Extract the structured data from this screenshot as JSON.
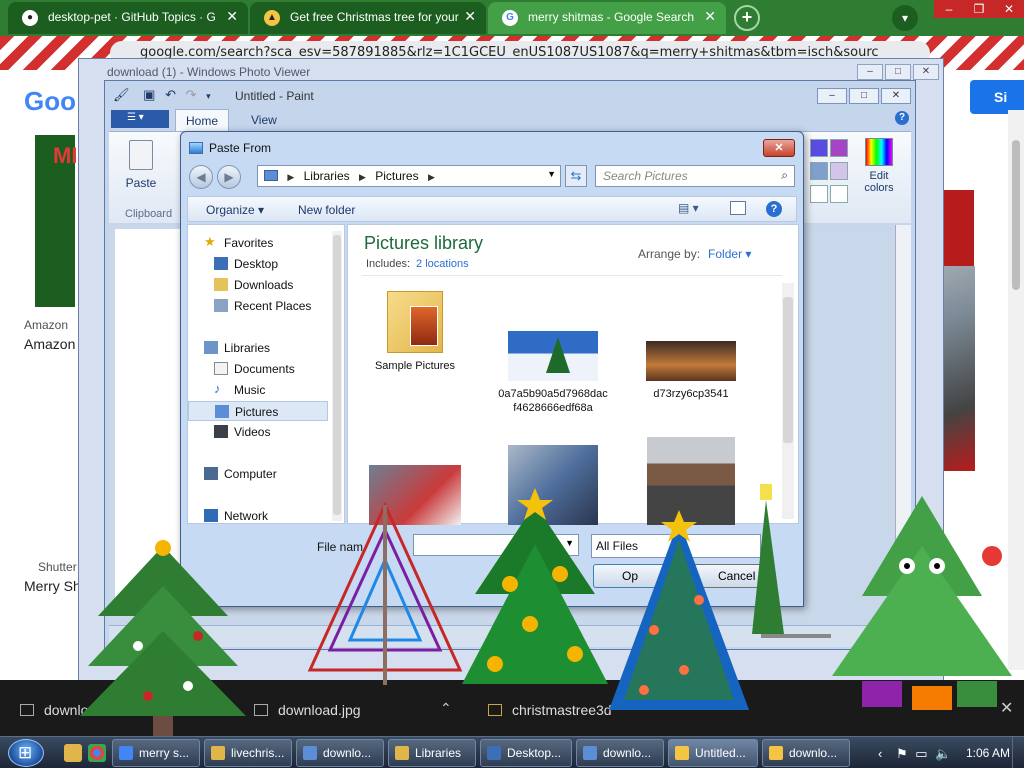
{
  "chrome": {
    "tabs": [
      {
        "title": "desktop-pet · GitHub Topics · G",
        "close": "✕"
      },
      {
        "title": "Get free Christmas tree for your",
        "close": "✕"
      },
      {
        "title": "merry shitmas - Google Search",
        "close": "✕"
      }
    ],
    "new_tab": "+",
    "address": "google.com/search?sca_esv=587891885&rlz=1C1GCEU_enUS1087US1087&q=merry+shitmas&tbm=isch&sourc",
    "signin_label": "Si",
    "left_results": [
      "Amazon",
      "Amazon",
      "Shutter",
      "Merry Sh"
    ],
    "left_logo": "Goo",
    "thumb_text": "MI"
  },
  "photo_viewer": {
    "title": "download (1) - Windows Photo Viewer"
  },
  "paint": {
    "title": "Untitled - Paint",
    "tabs": [
      "Home",
      "View"
    ],
    "paste_label": "Paste",
    "clipboard_label": "Clipboard",
    "edit_colors_label": "Edit colors"
  },
  "dialog": {
    "title": "Paste From",
    "path": [
      "Libraries",
      "Pictures"
    ],
    "search_placeholder": "Search Pictures",
    "toolbar": {
      "organize": "Organize ▾",
      "new_folder": "New folder"
    },
    "nav": {
      "favorites": "Favorites",
      "desktop": "Desktop",
      "downloads": "Downloads",
      "recent": "Recent Places",
      "libraries": "Libraries",
      "documents": "Documents",
      "music": "Music",
      "pictures": "Pictures",
      "videos": "Videos",
      "computer": "Computer",
      "network": "Network"
    },
    "library_title": "Pictures library",
    "includes_label": "Includes:",
    "includes_link": "2 locations",
    "arrange_label": "Arrange by:",
    "arrange_value": "Folder ▾",
    "items": [
      {
        "name": "Sample Pictures"
      },
      {
        "name": "0a7a5b90a5d7968dacf4628666edf68a"
      },
      {
        "name": "d73rzy6cp3541"
      },
      {
        "name": ""
      },
      {
        "name": ""
      },
      {
        "name": ""
      }
    ],
    "filename_label": "File nam",
    "filetype": "All Files",
    "open_label": "Op",
    "cancel_label": "Cancel"
  },
  "shelf": {
    "items": [
      "download",
      "download.jpg",
      "christmastree3d"
    ],
    "close": "✕"
  },
  "taskbar": {
    "buttons": [
      "merry s...",
      "livechris...",
      "downlo...",
      "Libraries",
      "Desktop...",
      "downlo...",
      "Untitled...",
      "downlo..."
    ],
    "clock": "1:06 AM"
  },
  "colors": {
    "chrome_tabbar": "#2e7d32",
    "dialog_frame": "#c7daf3",
    "link": "#2a6fd0"
  }
}
